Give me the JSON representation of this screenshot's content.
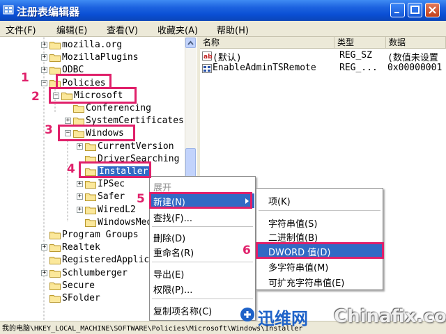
{
  "window": {
    "title": "注册表编辑器"
  },
  "menu": [
    "文件(F)",
    "编辑(E)",
    "查看(V)",
    "收藏夹(A)",
    "帮助(H)"
  ],
  "tree": [
    {
      "label": "mozilla.org",
      "expander": "+"
    },
    {
      "label": "MozillaPlugins",
      "expander": "+"
    },
    {
      "label": "ODBC",
      "expander": "+"
    },
    {
      "label": "Policies",
      "expander": "-"
    },
    {
      "label": "Microsoft",
      "expander": "-"
    },
    {
      "label": "Conferencing",
      "expander": ""
    },
    {
      "label": "SystemCertificates",
      "expander": "+"
    },
    {
      "label": "Windows",
      "expander": "-"
    },
    {
      "label": "CurrentVersion",
      "expander": "+"
    },
    {
      "label": "DriverSearching",
      "expander": ""
    },
    {
      "label": "Installer",
      "expander": ""
    },
    {
      "label": "IPSec",
      "expander": "+"
    },
    {
      "label": "Safer",
      "expander": "+"
    },
    {
      "label": "WiredL2",
      "expander": "+"
    },
    {
      "label": "WindowsMedia",
      "expander": ""
    },
    {
      "label": "Program Groups",
      "expander": ""
    },
    {
      "label": "Realtek",
      "expander": "+"
    },
    {
      "label": "RegisteredApplic",
      "expander": ""
    },
    {
      "label": "Schlumberger",
      "expander": "+"
    },
    {
      "label": "Secure",
      "expander": ""
    },
    {
      "label": "SFolder",
      "expander": ""
    }
  ],
  "values_table": {
    "headers": [
      "名称",
      "类型",
      "数据"
    ],
    "rows": [
      {
        "name": "(默认)",
        "type": "REG_SZ",
        "data": "(数值未设置"
      },
      {
        "name": "EnableAdminTSRemote",
        "type": "REG_...",
        "data": "0x00000001"
      }
    ]
  },
  "context_menu": {
    "items": [
      "展开",
      "新建(N)",
      "查找(F)...",
      "删除(D)",
      "重命名(R)",
      "导出(E)",
      "权限(P)...",
      "复制项名称(C)"
    ]
  },
  "new_submenu": {
    "items": [
      "项(K)",
      "字符串值(S)",
      "二进制值(B)",
      "DWORD 值(D)",
      "多字符串值(M)",
      "可扩充字符串值(E)"
    ]
  },
  "steps": [
    "1",
    "2",
    "3",
    "4",
    "5",
    "6"
  ],
  "statusbar": {
    "path": "我的电脑\\HKEY_LOCAL_MACHINE\\SOFTWARE\\Policies\\Microsoft\\Windows\\Installer"
  },
  "watermark": {
    "brand_cn": "迅维网",
    "brand_en": "Chinafix.com"
  },
  "colors": {
    "selection": "#316ac5",
    "annotation": "#e0206a",
    "titlebar": "#0a4fd4"
  }
}
